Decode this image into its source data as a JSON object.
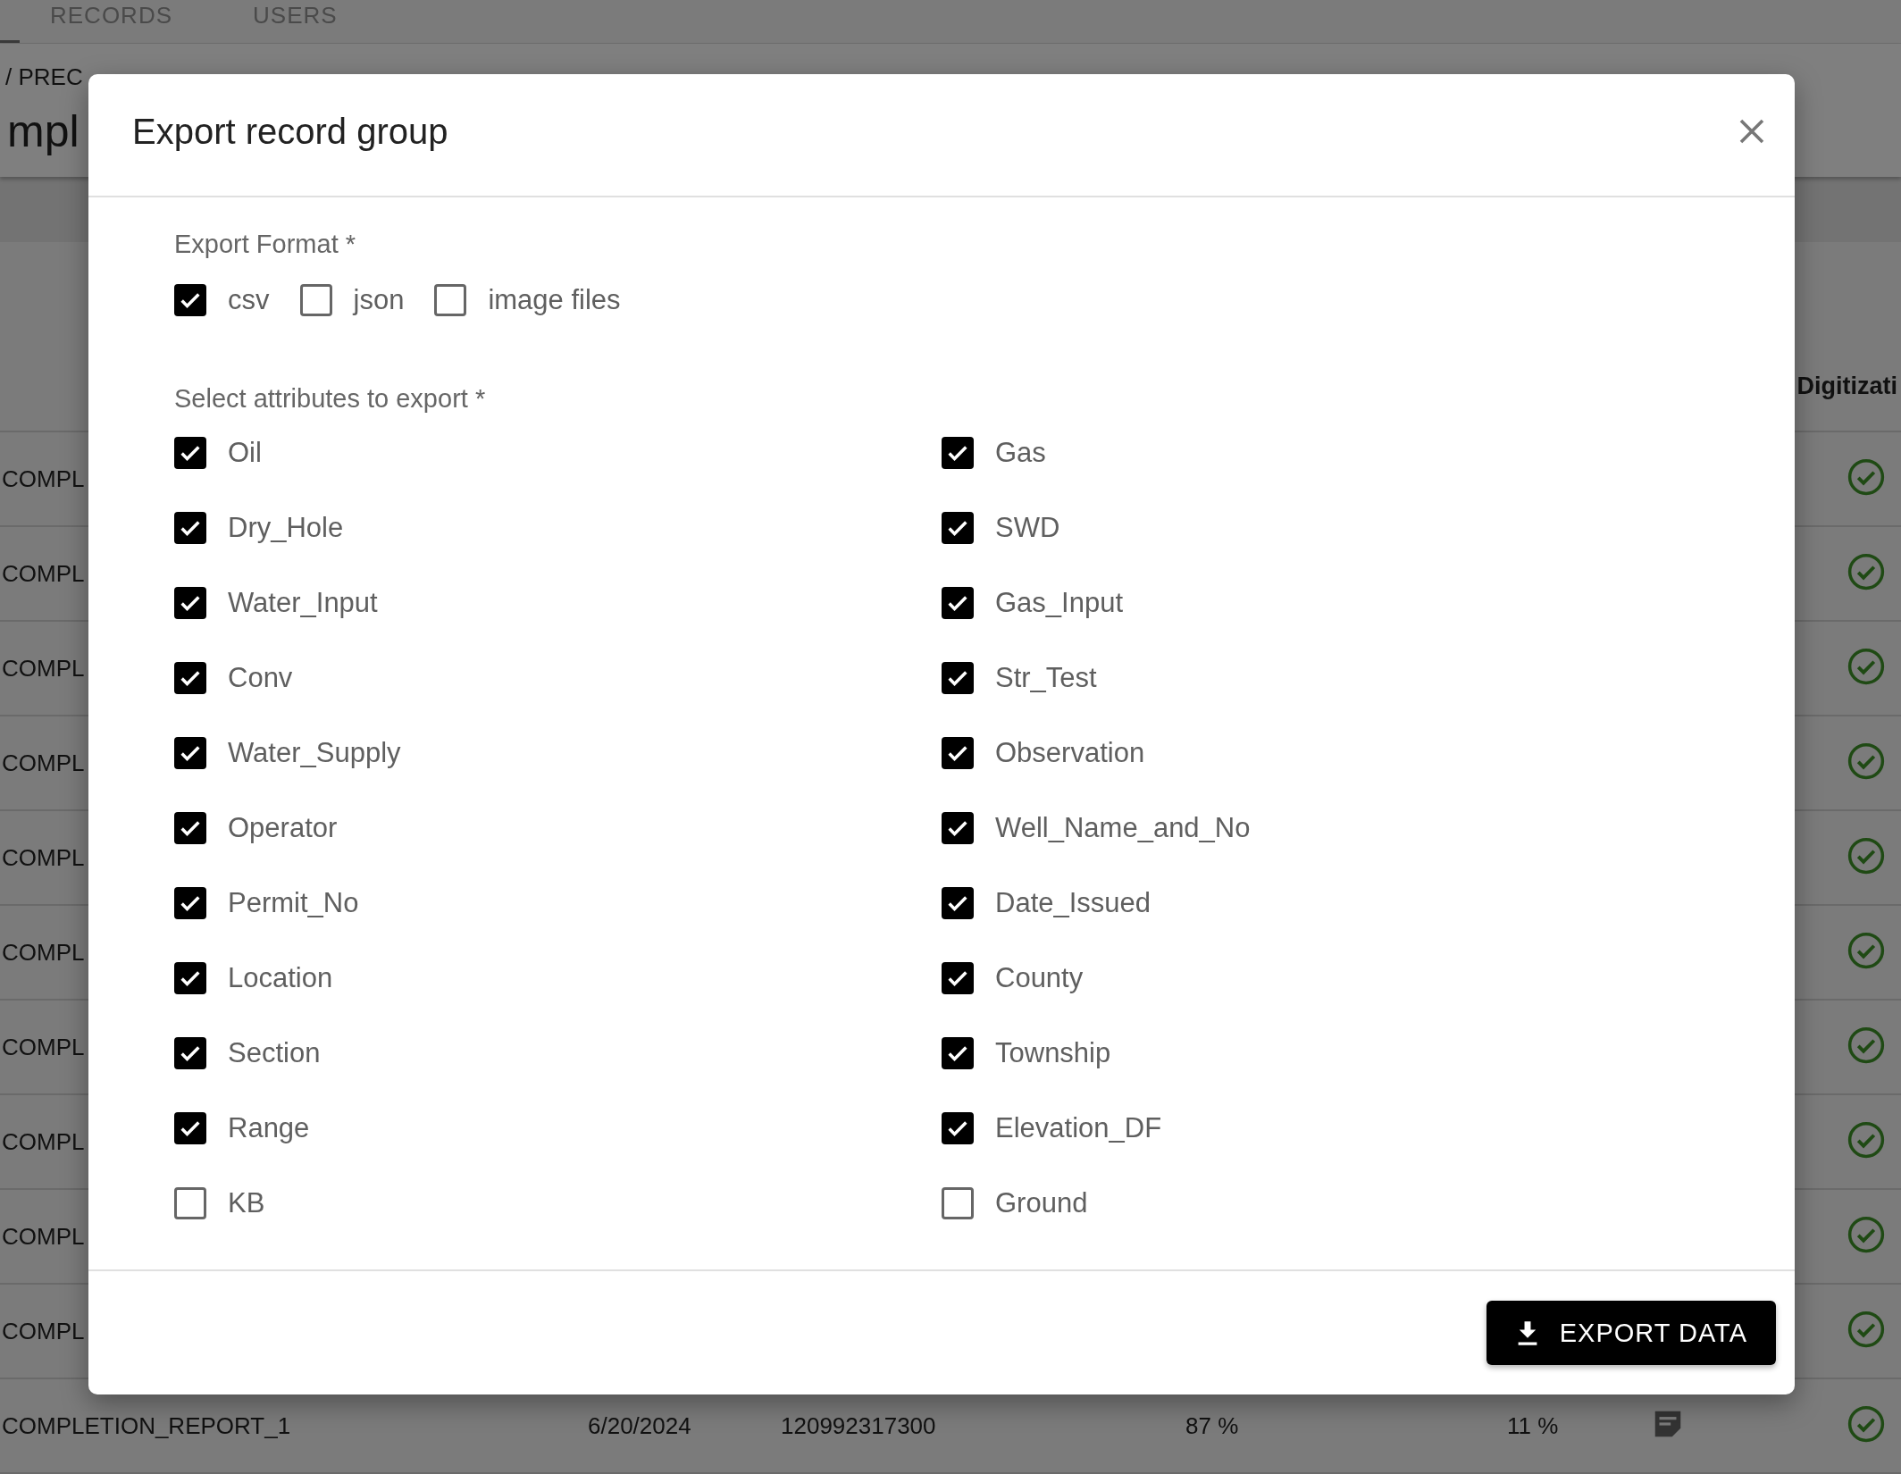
{
  "tabs": [
    {
      "label": "RECORDS"
    },
    {
      "label": "USERS"
    }
  ],
  "breadcrumb": "/ PREC",
  "page_title": "mpl",
  "table": {
    "column_header": "Digitizati",
    "rows": [
      {
        "cells": [
          "COMPL"
        ],
        "digitized": true
      },
      {
        "cells": [
          "COMPL"
        ],
        "digitized": true
      },
      {
        "cells": [
          "COMPL"
        ],
        "digitized": true
      },
      {
        "cells": [
          "COMPL"
        ],
        "digitized": true
      },
      {
        "cells": [
          "COMPL"
        ],
        "digitized": true
      },
      {
        "cells": [
          "COMPL"
        ],
        "digitized": true
      },
      {
        "cells": [
          "COMPL"
        ],
        "digitized": true
      },
      {
        "cells": [
          "COMPL"
        ],
        "digitized": true
      },
      {
        "cells": [
          "COMPL"
        ],
        "digitized": true
      },
      {
        "cells": [
          "COMPL"
        ],
        "digitized": true
      },
      {
        "cells": [
          "COMPLETION_REPORT_1",
          "6/20/2024",
          "120992317300",
          "87 %",
          "11 %"
        ],
        "has_note": true,
        "digitized": true
      }
    ]
  },
  "dialog": {
    "title": "Export record group",
    "format_label": "Export Format *",
    "formats": [
      {
        "label": "csv",
        "checked": true
      },
      {
        "label": "json",
        "checked": false
      },
      {
        "label": "image files",
        "checked": false
      }
    ],
    "attributes_label": "Select attributes to export *",
    "attributes": [
      {
        "label": "Oil",
        "checked": true
      },
      {
        "label": "Gas",
        "checked": true
      },
      {
        "label": "Dry_Hole",
        "checked": true
      },
      {
        "label": "SWD",
        "checked": true
      },
      {
        "label": "Water_Input",
        "checked": true
      },
      {
        "label": "Gas_Input",
        "checked": true
      },
      {
        "label": "Conv",
        "checked": true
      },
      {
        "label": "Str_Test",
        "checked": true
      },
      {
        "label": "Water_Supply",
        "checked": true
      },
      {
        "label": "Observation",
        "checked": true
      },
      {
        "label": "Operator",
        "checked": true
      },
      {
        "label": "Well_Name_and_No",
        "checked": true
      },
      {
        "label": "Permit_No",
        "checked": true
      },
      {
        "label": "Date_Issued",
        "checked": true
      },
      {
        "label": "Location",
        "checked": true
      },
      {
        "label": "County",
        "checked": true
      },
      {
        "label": "Section",
        "checked": true
      },
      {
        "label": "Township",
        "checked": true
      },
      {
        "label": "Range",
        "checked": true
      },
      {
        "label": "Elevation_DF",
        "checked": true
      },
      {
        "label": "KB",
        "checked": false
      },
      {
        "label": "Ground",
        "checked": false
      }
    ],
    "export_button": "EXPORT DATA"
  }
}
